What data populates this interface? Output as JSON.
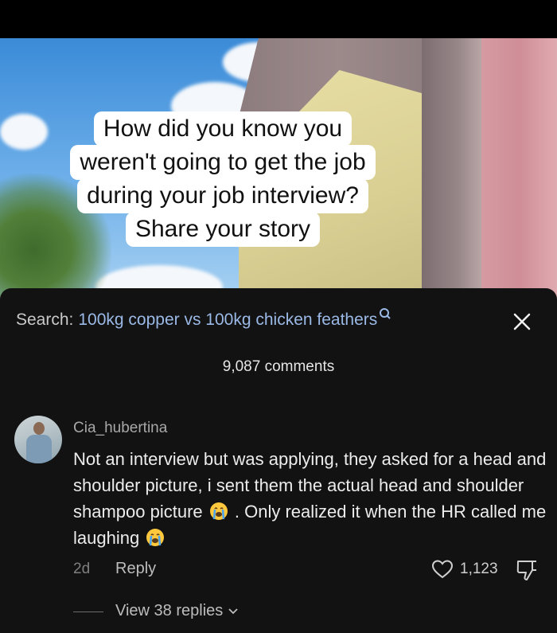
{
  "video": {
    "caption_lines": [
      "How did you know you",
      "weren't going to get the job",
      "during your job interview?",
      "Share your story"
    ]
  },
  "search": {
    "prefix": "Search:",
    "query": "100kg copper vs 100kg chicken feathers",
    "icon": "search-icon"
  },
  "close": {
    "icon": "close-icon"
  },
  "comments": {
    "count_label": "9,087 comments",
    "items": [
      {
        "username": "Cia_hubertina",
        "text_part1": "Not an interview but was applying, they asked for a head and shoulder picture, i sent them the actual head and shoulder shampoo picture",
        "text_part2": ". Only realized it when the HR called me laughing",
        "emoji": "loudly-crying-face",
        "time": "2d",
        "reply_label": "Reply",
        "like_count": "1,123",
        "view_replies_label": "View 38 replies"
      }
    ]
  },
  "colors": {
    "sheet_bg": "#121212",
    "search_query": "#9bb9e6",
    "text_primary": "#ececec",
    "text_secondary": "#a8a8a8"
  }
}
